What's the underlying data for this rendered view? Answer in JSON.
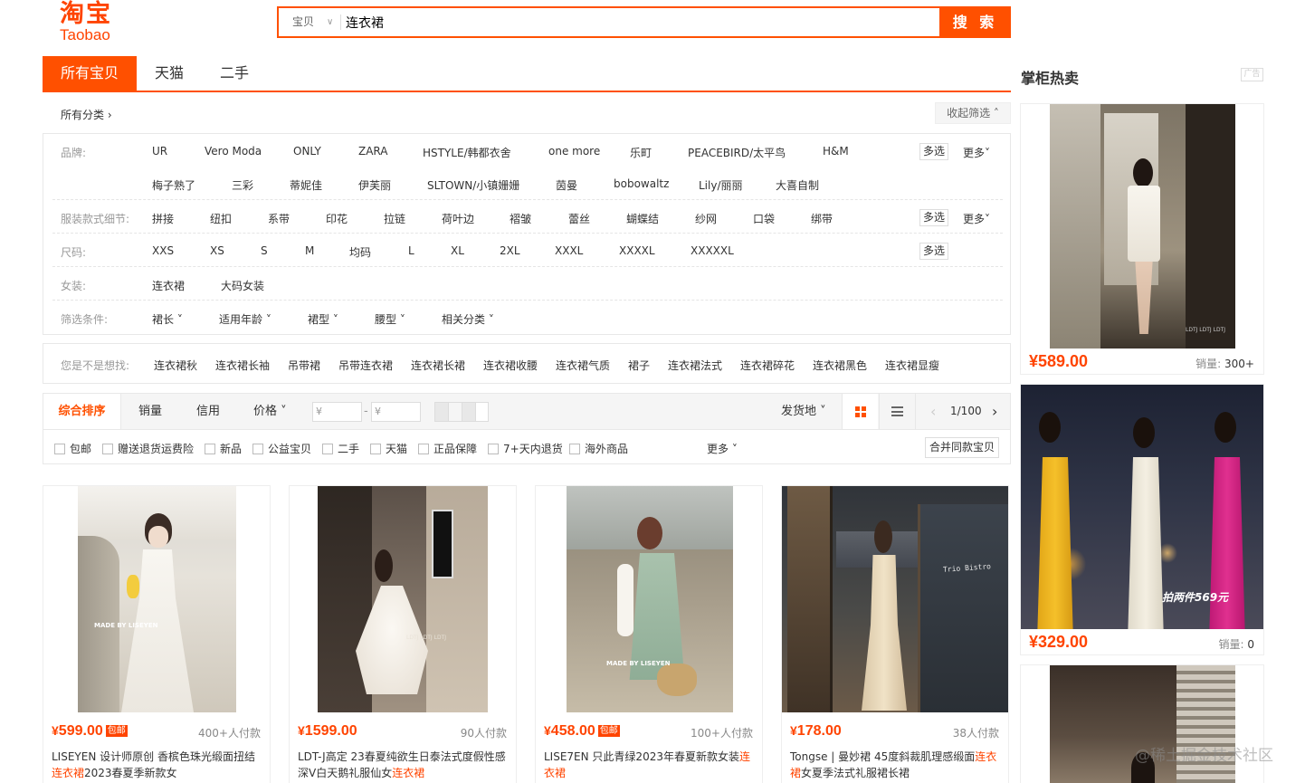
{
  "header": {
    "logo_cn": "淘宝",
    "logo_en": "Taobao",
    "search_type": "宝贝",
    "search_value": "连衣裙",
    "search_button": "搜 索"
  },
  "tabs": [
    "所有宝贝",
    "天猫",
    "二手"
  ],
  "breadcrumb": "所有分类 ›",
  "collapse_label": "收起筛选 ˄",
  "filters": {
    "brand": {
      "label": "品牌:",
      "row1": [
        "UR",
        "Vero Moda",
        "ONLY",
        "ZARA",
        "HSTYLE/韩都衣舍",
        "one more",
        "乐町",
        "PEACEBIRD/太平鸟",
        "H&M"
      ],
      "row2": [
        "梅子熟了",
        "三彩",
        "蒂妮佳",
        "伊芙丽",
        "SLTOWN/小镇姗姗",
        "茵曼",
        "bobowaltz",
        "Lily/丽丽",
        "大喜自制"
      ]
    },
    "style": {
      "label": "服装款式细节:",
      "items": [
        "拼接",
        "纽扣",
        "系带",
        "印花",
        "拉链",
        "荷叶边",
        "褶皱",
        "蕾丝",
        "蝴蝶结",
        "纱网",
        "口袋",
        "绑带"
      ]
    },
    "size": {
      "label": "尺码:",
      "items": [
        "XXS",
        "XS",
        "S",
        "M",
        "均码",
        "L",
        "XL",
        "2XL",
        "XXXL",
        "XXXXL",
        "XXXXXL"
      ]
    },
    "women": {
      "label": "女装:",
      "items": [
        "连衣裙",
        "大码女装"
      ]
    },
    "conditions": {
      "label": "筛选条件:",
      "items": [
        "裙长 ˅",
        "适用年龄 ˅",
        "裙型 ˅",
        "腰型 ˅",
        "相关分类 ˅"
      ]
    },
    "multi": "多选",
    "more": "更多˅"
  },
  "suggestions": {
    "label": "您是不是想找:",
    "items": [
      "连衣裙秋",
      "连衣裙长袖",
      "吊带裙",
      "吊带连衣裙",
      "连衣裙长裙",
      "连衣裙收腰",
      "连衣裙气质",
      "裙子",
      "连衣裙法式",
      "连衣裙碎花",
      "连衣裙黑色",
      "连衣裙显瘦"
    ]
  },
  "sort": {
    "items": [
      "综合排序",
      "销量",
      "信用",
      "价格 ˅"
    ],
    "price_placeholder": "¥",
    "ship_from": "发货地 ˅",
    "page": "1/100",
    "prev": "‹",
    "next": "›"
  },
  "checks": [
    "包邮",
    "赠送退货运费险",
    "新品",
    "公益宝贝",
    "二手",
    "天猫",
    "正品保障",
    "7+天内退货",
    "海外商品"
  ],
  "checks_more": "更多 ˅",
  "merge_label": "合并同款宝贝",
  "products": [
    {
      "price": "599.00",
      "baoyou": "包邮",
      "deals": "400+人付款",
      "title_pre": "LISEYEN 设计师原创 香槟色珠光缎面扭结",
      "title_hl": "连衣裙",
      "title_post": "2023春夏季新款女",
      "img_caption": "MADE BY LISEYEN"
    },
    {
      "price": "1599.00",
      "baoyou": "",
      "deals": "90人付款",
      "title_pre": "LDT-J高定 23春夏纯欲生日泰法式度假性感深V白天鹅礼服仙女",
      "title_hl": "连衣裙",
      "title_post": "",
      "img_caption": "LDTJ LDTJ LDTJ"
    },
    {
      "price": "458.00",
      "baoyou": "包邮",
      "deals": "100+人付款",
      "title_pre": "LISE7EN 只此青绿2023年春夏新款女装",
      "title_hl": "连衣裙",
      "title_post": "",
      "img_caption": "MADE BY LISEYEN"
    },
    {
      "price": "178.00",
      "baoyou": "",
      "deals": "38人付款",
      "title_pre": "Tongse | 曼妙裙 45度斜裁肌理感缎面",
      "title_hl": "连衣裙",
      "title_post": "女夏季法式礼服裙长裙",
      "img_caption": "Trio Bistro"
    }
  ],
  "ads": {
    "title": "掌柜热卖",
    "tag": "广告",
    "items": [
      {
        "price": "589.00",
        "sales_label": "销量:",
        "sales": "300+",
        "img_caption": "LDTJ LDTJ LDTJ"
      },
      {
        "price": "329.00",
        "sales_label": "销量:",
        "sales": "0",
        "img_caption": "拍两件569元"
      }
    ]
  },
  "yen": "¥",
  "watermark": "@稀土掘金技术社区",
  "colors": {
    "accent": "#ff5000",
    "price": "#ff4400"
  }
}
